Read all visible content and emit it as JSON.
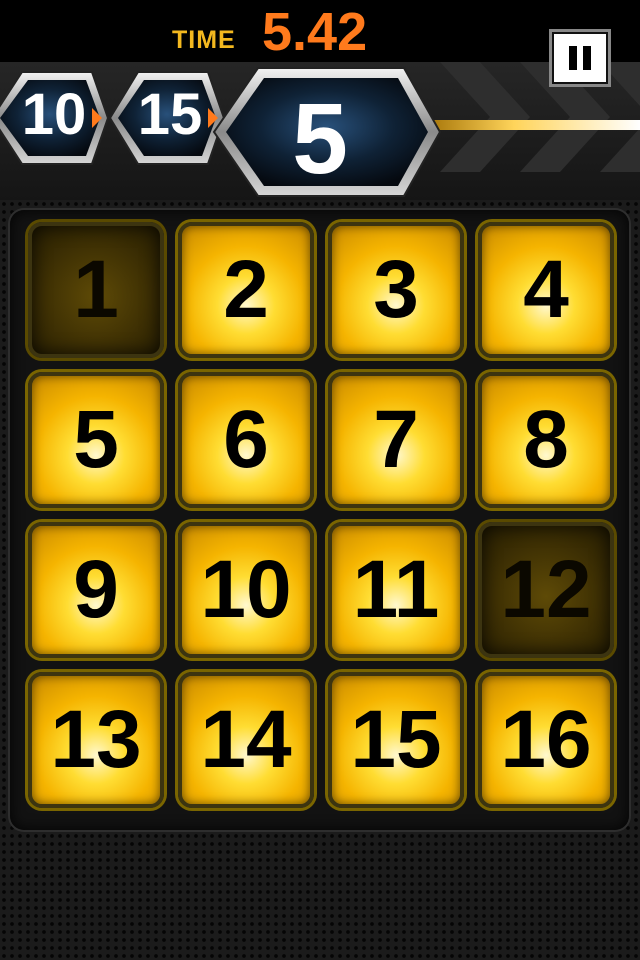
{
  "header": {
    "time_label": "TIME",
    "time_value": "5.42",
    "pause_icon": "pause-icon"
  },
  "hud": {
    "queue": [
      "10",
      "15"
    ],
    "current": "5"
  },
  "board": {
    "tiles": [
      {
        "label": "1",
        "state": "cleared"
      },
      {
        "label": "2",
        "state": "active"
      },
      {
        "label": "3",
        "state": "active"
      },
      {
        "label": "4",
        "state": "active"
      },
      {
        "label": "5",
        "state": "active"
      },
      {
        "label": "6",
        "state": "active"
      },
      {
        "label": "7",
        "state": "active"
      },
      {
        "label": "8",
        "state": "active"
      },
      {
        "label": "9",
        "state": "active"
      },
      {
        "label": "10",
        "state": "active"
      },
      {
        "label": "11",
        "state": "active"
      },
      {
        "label": "12",
        "state": "cleared"
      },
      {
        "label": "13",
        "state": "active"
      },
      {
        "label": "14",
        "state": "active"
      },
      {
        "label": "15",
        "state": "active"
      },
      {
        "label": "16",
        "state": "active"
      }
    ]
  },
  "colors": {
    "tile_glow": "#ffdd33",
    "time_label": "#f3b81f",
    "time_value": "#ff7a1c"
  }
}
